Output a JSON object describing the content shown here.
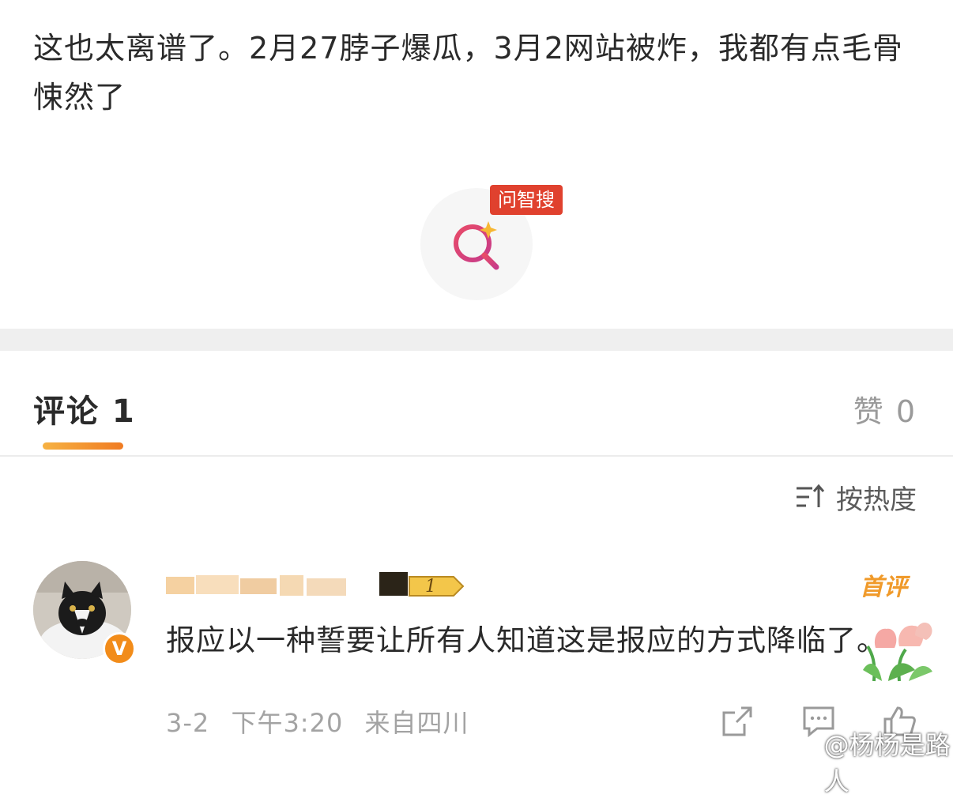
{
  "post": {
    "text": "这也太离谱了。2月27脖子爆瓜，3月2网站被炸，我都有点毛骨悚然了"
  },
  "ai_search": {
    "badge": "问智搜",
    "icon": "sparkle-search-icon"
  },
  "tabs": {
    "comments_label": "评论 1",
    "likes_label": "赞 0",
    "accent": "#f07b22"
  },
  "sort": {
    "label": "按热度",
    "icon": "sort-icon"
  },
  "comment": {
    "avatar": "cat-avatar",
    "vip_badge": "V",
    "first_label": "首评",
    "text": "报应以一种誓要让所有人知道这是报应的方式降临了。",
    "date": "3-2",
    "time": "下午3:20",
    "location": "来自四川",
    "actions": [
      "share-icon",
      "comment-icon",
      "like-icon"
    ]
  },
  "watermark": {
    "text": "@杨杨是路人",
    "icon": "weibo-icon"
  }
}
